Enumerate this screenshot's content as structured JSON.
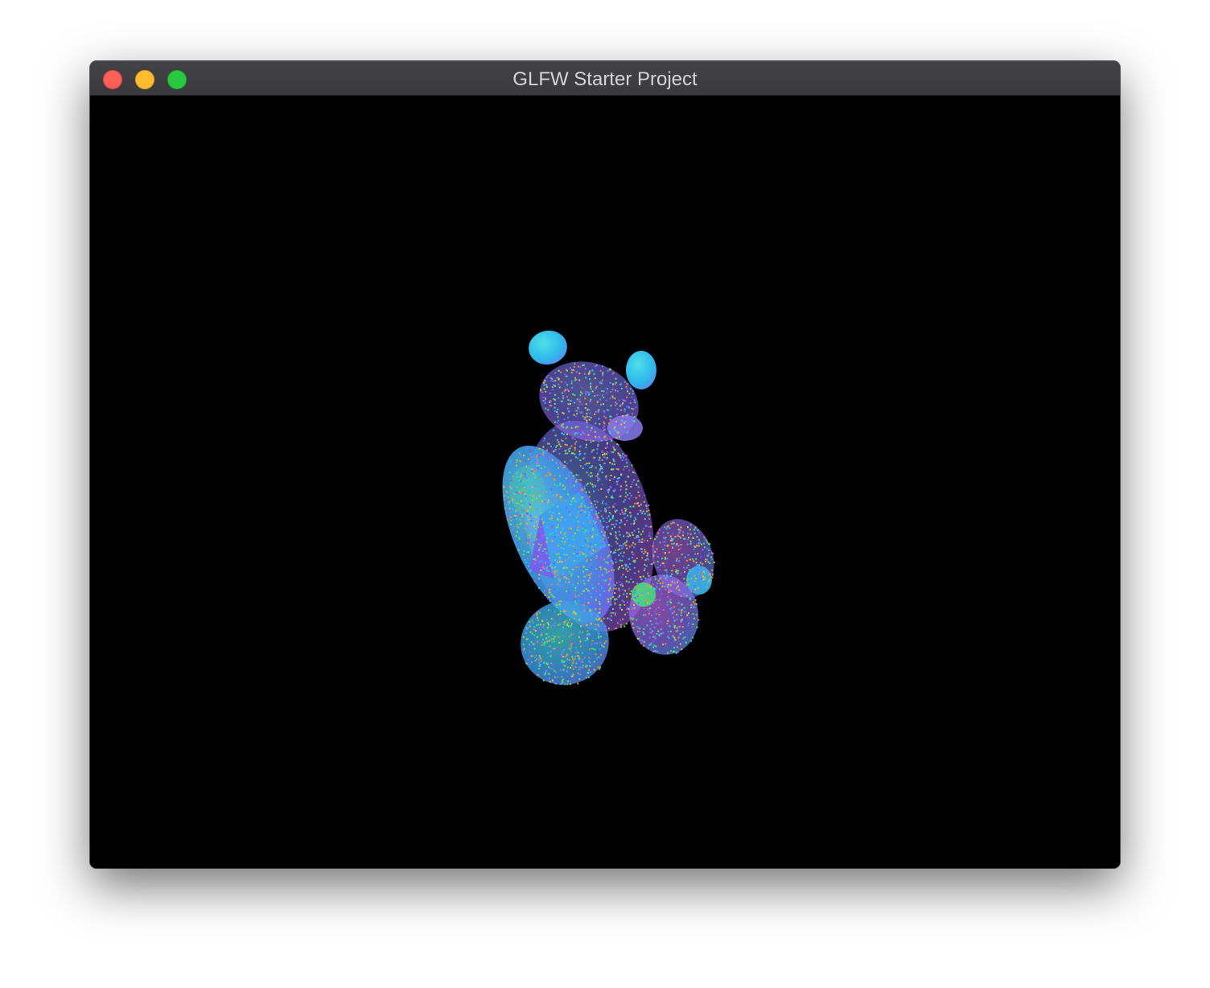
{
  "window": {
    "title": "GLFW Starter Project",
    "controls": {
      "close": "close-icon",
      "minimize": "minimize-icon",
      "maximize": "maximize-icon"
    }
  },
  "viewport": {
    "background": "#000000",
    "content": "teddy-bear-point-cloud",
    "palette": [
      "#35c8e8",
      "#3fa0f0",
      "#7a5cf0",
      "#b06ae8",
      "#44e07a",
      "#7ee04a",
      "#f08a3a",
      "#e8c040"
    ]
  }
}
